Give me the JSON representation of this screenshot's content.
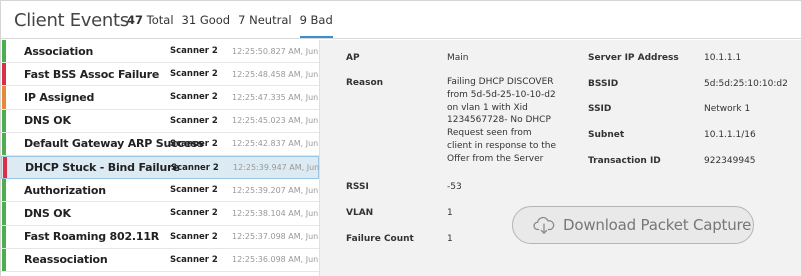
{
  "header": {
    "title": "Client Events",
    "filters": [
      {
        "count": "47",
        "label": "Total"
      },
      {
        "count": "31",
        "label": "Good"
      },
      {
        "count": "7",
        "label": "Neutral"
      },
      {
        "count": "9",
        "label": "Bad"
      }
    ],
    "active_filter": "Bad"
  },
  "status_colors": {
    "good": "#4cae4f",
    "bad": "#d9304a",
    "neutral": "#e8893a",
    "selected_bg": "#dbeaf3"
  },
  "events": [
    {
      "name": "Association",
      "scanner": "Scanner 2",
      "time": "12:25:50.827 AM, Jun 30",
      "status": "good"
    },
    {
      "name": "Fast BSS Assoc Failure",
      "scanner": "Scanner 2",
      "time": "12:25:48.458 AM, Jun 30",
      "status": "bad"
    },
    {
      "name": "IP Assigned",
      "scanner": "Scanner 2",
      "time": "12:25:47.335 AM, Jun 30",
      "status": "neutral"
    },
    {
      "name": "DNS OK",
      "scanner": "Scanner 2",
      "time": "12:25:45.023 AM, Jun 30",
      "status": "good"
    },
    {
      "name": "Default Gateway ARP Success",
      "scanner": "Scanner 2",
      "time": "12:25:42.837 AM, Jun 30",
      "status": "good"
    },
    {
      "name": "DHCP Stuck - Bind Failure",
      "scanner": "Scanner 2",
      "time": "12:25:39.947 AM, Jun 30",
      "status": "bad",
      "selected": true
    },
    {
      "name": "Authorization",
      "scanner": "Scanner 2",
      "time": "12:25:39.207 AM, Jun 30",
      "status": "good"
    },
    {
      "name": "DNS OK",
      "scanner": "Scanner 2",
      "time": "12:25:38.104 AM, Jun 30",
      "status": "good"
    },
    {
      "name": "Fast Roaming 802.11R",
      "scanner": "Scanner 2",
      "time": "12:25:37.098 AM, Jun 30",
      "status": "good"
    },
    {
      "name": "Reassociation",
      "scanner": "Scanner 2",
      "time": "12:25:36.098 AM, Jun 30",
      "status": "good"
    }
  ],
  "detail": {
    "ap_label": "AP",
    "ap_value": "Main",
    "reason_label": "Reason",
    "reason_lines": [
      "Failing DHCP DISCOVER",
      "from 5d-5d-25-10-10-d2",
      "on vlan 1 with Xid",
      "1234567728- No DHCP",
      "Request seen from",
      "client in response to the",
      "Offer from the Server"
    ],
    "server_ip_label": "Server IP Address",
    "server_ip_value": "10.1.1.1",
    "bssid_label": "BSSID",
    "bssid_value": "5d:5d:25:10:10:d2",
    "ssid_label": "SSID",
    "ssid_value": "Network 1",
    "subnet_label": "Subnet",
    "subnet_value": "10.1.1.1/16",
    "transaction_label": "Transaction ID",
    "transaction_value": "922349945",
    "rssi_label": "RSSI",
    "rssi_value": "-53",
    "vlan_label": "VLAN",
    "vlan_value": "1",
    "failure_label": "Failure Count",
    "failure_value": "1",
    "download_label": "Download Packet Capture",
    "download_icon": "cloud-download-icon"
  }
}
